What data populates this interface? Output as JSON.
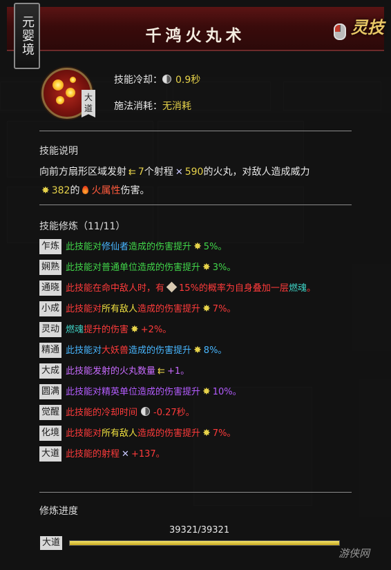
{
  "header": {
    "title": "千鸿火丸术",
    "realm": "元婴境",
    "category": "灵技"
  },
  "skill": {
    "tier": "大道",
    "cooldown_label": "技能冷却：",
    "cooldown_value": "0.9秒",
    "cost_label": "施法消耗：",
    "cost_value": "无消耗"
  },
  "description": {
    "section_title": "技能说明",
    "part1": "向前方扇形区域发射",
    "count": "7",
    "part2": "个射程",
    "range": "590",
    "part3": "的火丸，对敌人造成威力",
    "power": "382",
    "part4": "的",
    "element": "火属性",
    "part5": "伤害。"
  },
  "cultivation": {
    "section_title": "技能修炼（11/11）",
    "modifiers": [
      {
        "tag": "乍炼",
        "segments": [
          {
            "t": "此技能对",
            "c": "c-green"
          },
          {
            "t": "修仙者",
            "c": "c-blue"
          },
          {
            "t": "造成的伤害提升",
            "c": "c-green"
          },
          {
            "icon": "star"
          },
          {
            "t": "5%。",
            "c": "c-green"
          }
        ]
      },
      {
        "tag": "娴熟",
        "segments": [
          {
            "t": "此技能对普通单位造成的伤害提升",
            "c": "c-green"
          },
          {
            "icon": "star"
          },
          {
            "t": "3%。",
            "c": "c-green"
          }
        ]
      },
      {
        "tag": "通晓",
        "segments": [
          {
            "t": "此技能在命中敌人时，有",
            "c": "c-red"
          },
          {
            "icon": "cube"
          },
          {
            "t": "15%的概率为自身叠加一层",
            "c": "c-red"
          },
          {
            "t": "燃魂",
            "c": "c-teal"
          },
          {
            "t": "。",
            "c": "c-red"
          }
        ]
      },
      {
        "tag": "小成",
        "segments": [
          {
            "t": "此技能对",
            "c": "c-red"
          },
          {
            "t": "所有敌人",
            "c": "c-yellow"
          },
          {
            "t": "造成的伤害提升",
            "c": "c-red"
          },
          {
            "icon": "star"
          },
          {
            "t": "7%。",
            "c": "c-red"
          }
        ]
      },
      {
        "tag": "灵动",
        "segments": [
          {
            "t": "燃魂",
            "c": "c-teal"
          },
          {
            "t": "提升的伤害",
            "c": "c-red"
          },
          {
            "icon": "star"
          },
          {
            "t": "+2%。",
            "c": "c-red"
          }
        ]
      },
      {
        "tag": "精通",
        "segments": [
          {
            "t": "此技能对",
            "c": "c-blue"
          },
          {
            "t": "大妖兽",
            "c": "c-red"
          },
          {
            "t": "造成的伤害提升",
            "c": "c-blue"
          },
          {
            "icon": "star"
          },
          {
            "t": "8%。",
            "c": "c-blue"
          }
        ]
      },
      {
        "tag": "大成",
        "segments": [
          {
            "t": "此技能发射的火丸数量",
            "c": "c-purple"
          },
          {
            "icon": "arrow"
          },
          {
            "t": "+1。",
            "c": "c-purple"
          }
        ]
      },
      {
        "tag": "圆满",
        "segments": [
          {
            "t": "此技能对精英单位造成的伤害提升",
            "c": "c-violet"
          },
          {
            "icon": "star"
          },
          {
            "t": "10%。",
            "c": "c-violet"
          }
        ]
      },
      {
        "tag": "觉醒",
        "segments": [
          {
            "t": "此技能的冷却时间",
            "c": "c-red"
          },
          {
            "icon": "cd"
          },
          {
            "t": "-0.27秒。",
            "c": "c-red"
          }
        ]
      },
      {
        "tag": "化境",
        "segments": [
          {
            "t": "此技能对",
            "c": "c-red"
          },
          {
            "t": "所有敌人",
            "c": "c-yellow"
          },
          {
            "t": "造成的伤害提升",
            "c": "c-red"
          },
          {
            "icon": "star"
          },
          {
            "t": "7%。",
            "c": "c-red"
          }
        ]
      },
      {
        "tag": "大道",
        "segments": [
          {
            "t": "此技能的射程",
            "c": "c-red"
          },
          {
            "icon": "x"
          },
          {
            "t": "+137。",
            "c": "c-red"
          }
        ]
      }
    ]
  },
  "progress": {
    "section_title": "修炼进度",
    "value_text": "39321/39321",
    "fraction": 1.0,
    "tier_tag": "大道"
  },
  "watermark": "游侠网",
  "colors": {
    "title_bar": "#5b1414",
    "highlight_yellow": "#e6d24a",
    "fire": "#ff5a3c"
  }
}
